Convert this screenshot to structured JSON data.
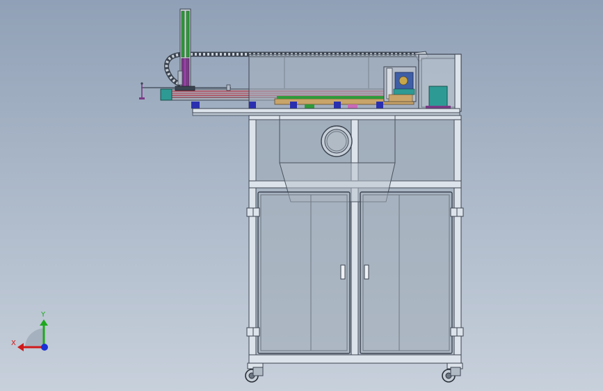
{
  "triad": {
    "y_label": "Y",
    "x_label": "X",
    "colors": {
      "y": "#1ea81e",
      "x": "#d01a1a",
      "z": "#1a32d6"
    }
  },
  "palette": {
    "frame": "#dde3ea",
    "frame_edge": "#3b4350",
    "glass": "#9aa6b4",
    "rail_red": "#b3263a",
    "rail_green": "#2f9a3a",
    "column_purple": "#7a3a86",
    "block_teal": "#2e9a94",
    "pad_blue": "#2a2fb0"
  }
}
